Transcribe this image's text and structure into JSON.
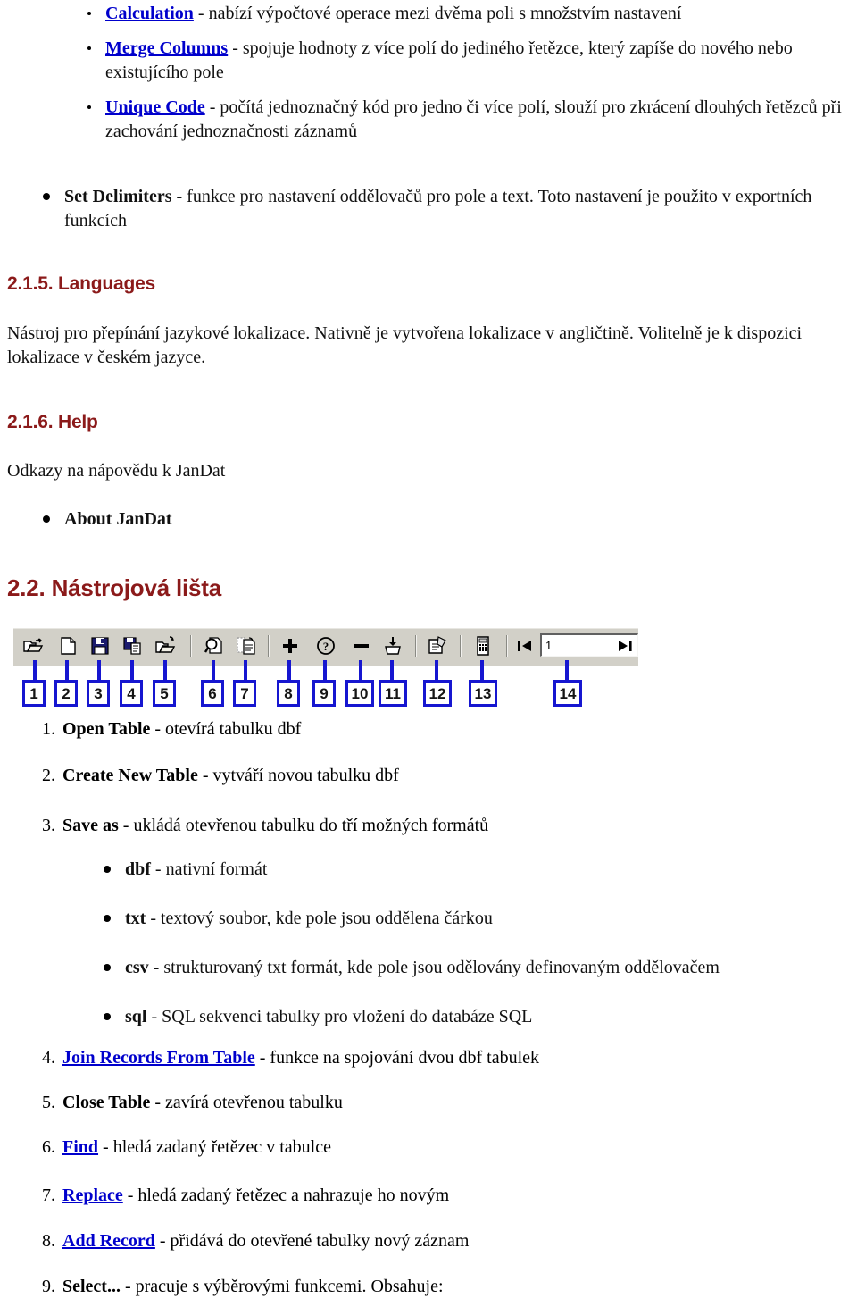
{
  "document": {
    "language": "cs",
    "colors": {
      "heading": "#8b1a1a",
      "link": "#0000cc",
      "callout_border": "#1616d0",
      "toolbar_background": "#d2d0c8"
    }
  },
  "intro_bullets": [
    {
      "link": "Calculation",
      "text": " - nabízí výpočtové operace mezi dvěma poli s množstvím nastavení"
    },
    {
      "link": "Merge Columns",
      "text": " - spojuje hodnoty z více polí do jediného řetězce, který zapíše do nového nebo existujícího pole"
    },
    {
      "link": "Unique Code",
      "text": " - počítá jednoznačný kód pro jedno či více polí, slouží pro zkrácení dlouhých řetězců při zachování jednoznačnosti záznamů"
    }
  ],
  "set_delimiters": {
    "bold": "Set Delimiters",
    "text": " - funkce pro nastavení oddělovačů pro pole a text. Toto nastavení je použito v exportních funkcích"
  },
  "section_languages": {
    "heading": "2.1.5. Languages",
    "paragraph": "Nástroj pro přepínání jazykové lokalizace. Nativně je vytvořena lokalizace v angličtině. Volitelně je k dispozici lokalizace v českém jazyce."
  },
  "section_help": {
    "heading": "2.1.6. Help",
    "paragraph": "Odkazy na nápovědu k JanDat",
    "bullet": "About JanDat"
  },
  "section_toolbar": {
    "heading": "2.2. Nástrojová lišta",
    "figure": {
      "field_value": "1",
      "icons": [
        {
          "n": 1,
          "name": "open-folder-icon"
        },
        {
          "n": 2,
          "name": "new-document-icon"
        },
        {
          "n": 3,
          "name": "save-floppy-icon"
        },
        {
          "n": 4,
          "name": "save-as-icon"
        },
        {
          "n": 5,
          "name": "open-folder-join-icon"
        },
        {
          "n": 6,
          "name": "find-magnifier-icon"
        },
        {
          "n": 7,
          "name": "replace-document-icon"
        },
        {
          "n": 8,
          "name": "plus-add-record-icon"
        },
        {
          "n": 9,
          "name": "question-select-icon"
        },
        {
          "n": 10,
          "name": "minus-delete-icon"
        },
        {
          "n": 11,
          "name": "import-basket-icon"
        },
        {
          "n": 12,
          "name": "properties-icon"
        },
        {
          "n": 13,
          "name": "calculator-icon"
        },
        {
          "n": 14,
          "name": "record-navigator-field"
        }
      ],
      "nav_first_label": "|◀",
      "nav_last_label": "▶|",
      "callout_labels": [
        "1",
        "2",
        "3",
        "4",
        "5",
        "6",
        "7",
        "8",
        "9",
        "10",
        "11",
        "12",
        "13",
        "14"
      ]
    },
    "items": [
      {
        "index": "1.",
        "title": "Open Table",
        "title_is_link": false,
        "text": " - otevírá tabulku dbf"
      },
      {
        "index": "2.",
        "title": "Create New Table",
        "title_is_link": false,
        "text": " - vytváří novou tabulku dbf"
      },
      {
        "index": "3.",
        "title": "Save as",
        "title_is_link": false,
        "text": " - ukládá otevřenou tabulku do tří možných formátů"
      },
      {
        "index": "4.",
        "title": "Join Records From Table",
        "title_is_link": true,
        "text": " - funkce na spojování dvou dbf tabulek"
      },
      {
        "index": "5.",
        "title": "Close Table",
        "title_is_link": false,
        "text": " - zavírá otevřenou tabulku"
      },
      {
        "index": "6.",
        "title": "Find",
        "title_is_link": true,
        "text": " - hledá zadaný řetězec v tabulce"
      },
      {
        "index": "7.",
        "title": "Replace",
        "title_is_link": true,
        "text": " - hledá zadaný řetězec a nahrazuje ho novým"
      },
      {
        "index": "8.",
        "title": "Add Record",
        "title_is_link": true,
        "text": " - přidává do otevřené tabulky nový záznam"
      },
      {
        "index": "9.",
        "title": "Select...",
        "title_is_link": false,
        "text": " - pracuje s výběrovými funkcemi. Obsahuje:"
      }
    ],
    "formats": [
      {
        "name": "dbf",
        "text": " - nativní formát"
      },
      {
        "name": "txt",
        "text": " - textový soubor, kde pole jsou oddělena čárkou"
      },
      {
        "name": "csv",
        "text": " - strukturovaný txt formát, kde pole jsou odělovány definovaným oddělovačem"
      },
      {
        "name": "sql",
        "text": " - SQL sekvenci tabulky pro vložení do databáze SQL"
      }
    ]
  }
}
